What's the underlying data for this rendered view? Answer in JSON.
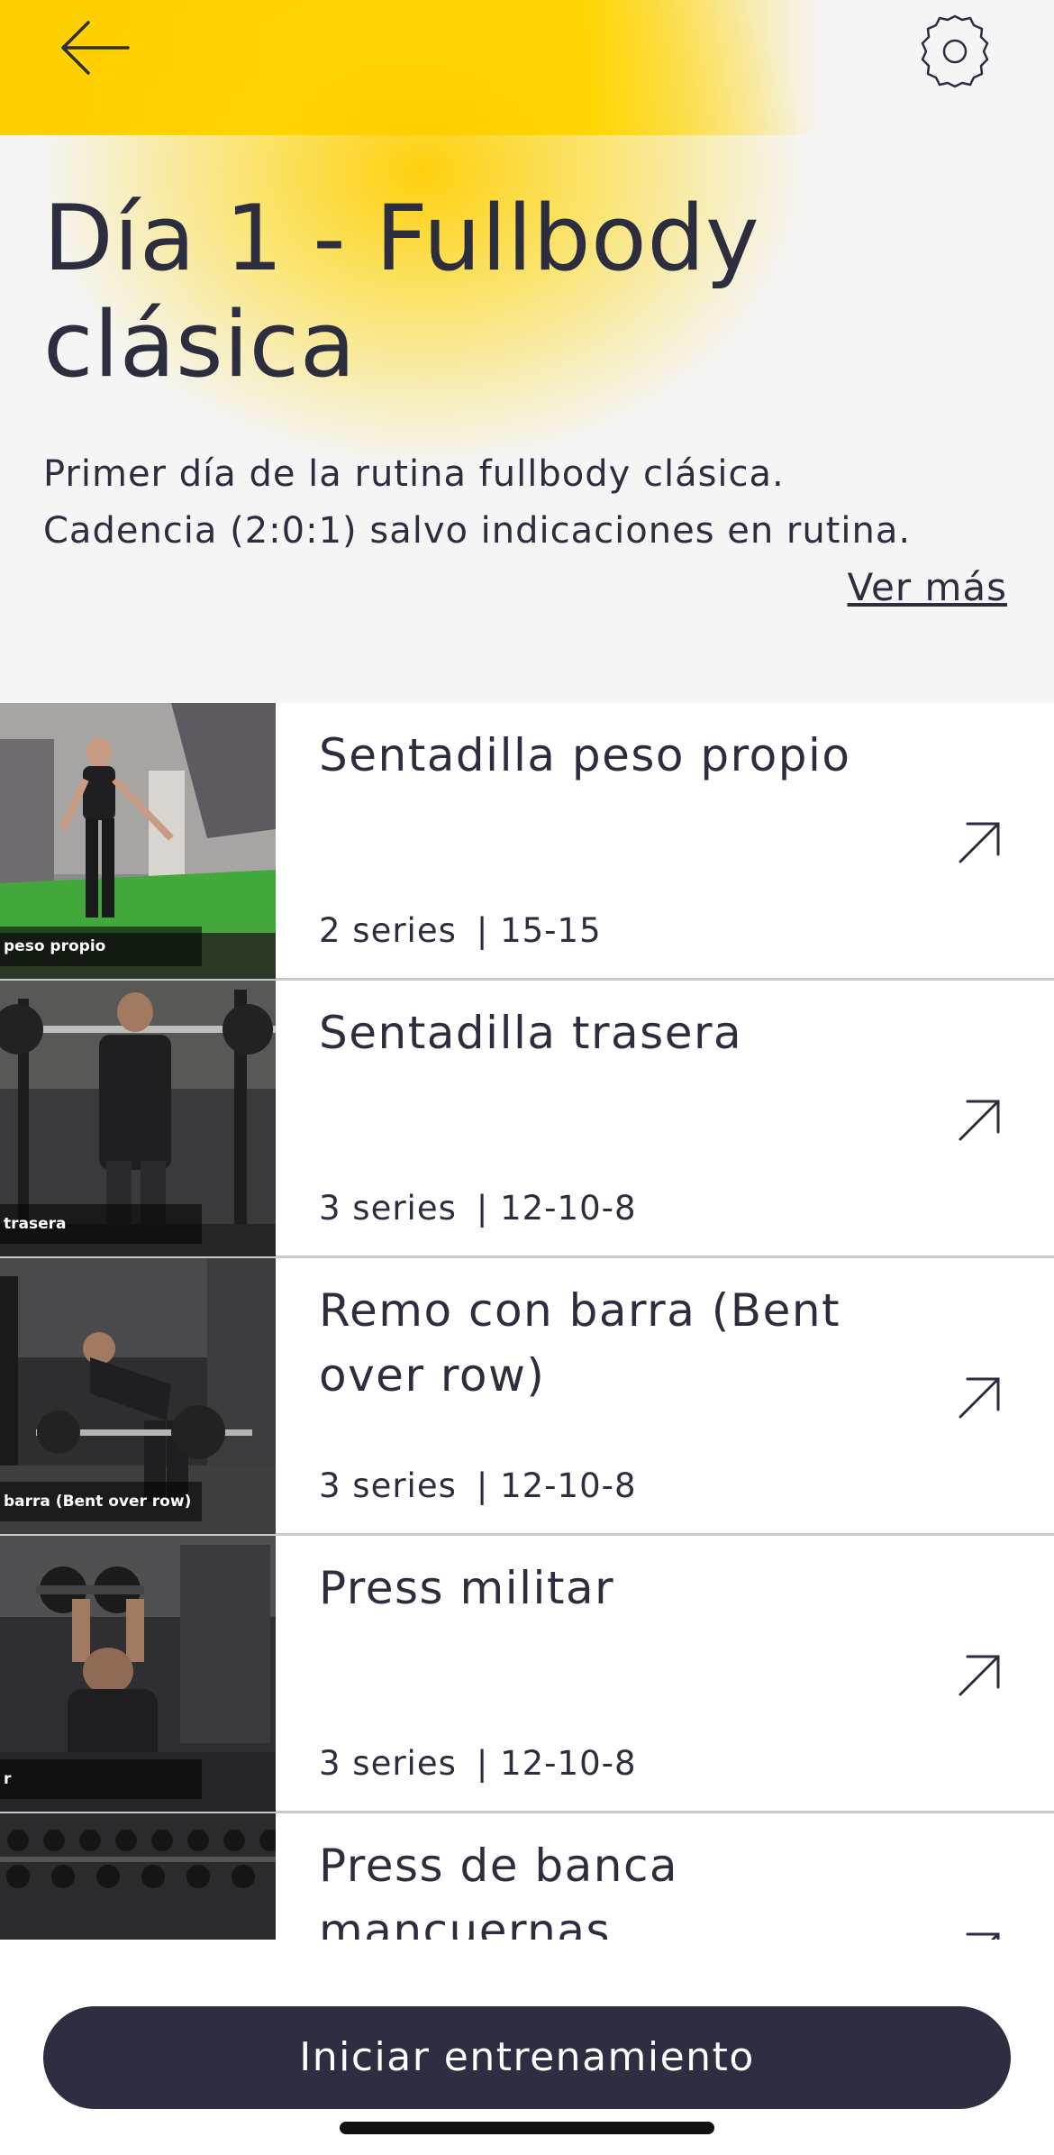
{
  "header": {
    "back_icon": "arrow-left-icon",
    "settings_icon": "gear-icon",
    "accent_color": "#ffd400"
  },
  "routine": {
    "title": "Día 1 - Fullbody clásica",
    "description_line1": "Primer día de la rutina fullbody clásica.",
    "description_line2": "Cadencia (2:0:1) salvo indicaciones en rutina.",
    "see_more": "Ver más"
  },
  "exercises": [
    {
      "name": "Sentadilla peso propio",
      "series": "2 series",
      "reps": "| 15-15",
      "thumb_caption": "peso propio",
      "arrow_icon": "arrow-up-right-icon"
    },
    {
      "name": "Sentadilla trasera",
      "series": "3 series",
      "reps": "| 12-10-8",
      "thumb_caption": "trasera",
      "arrow_icon": "arrow-up-right-icon"
    },
    {
      "name": "Remo con barra (Bent over row)",
      "series": "3 series",
      "reps": "| 12-10-8",
      "thumb_caption": "barra (Bent over row)",
      "arrow_icon": "arrow-up-right-icon"
    },
    {
      "name": "Press militar",
      "series": "3 series",
      "reps": "| 12-10-8",
      "thumb_caption": "r",
      "arrow_icon": "arrow-up-right-icon"
    },
    {
      "name": "Press de banca mancuernas",
      "series": "",
      "reps": "",
      "thumb_caption": "",
      "arrow_icon": "arrow-up-right-icon"
    }
  ],
  "footer": {
    "start_button": "Iniciar entrenamiento",
    "button_color": "#2d2e42"
  }
}
